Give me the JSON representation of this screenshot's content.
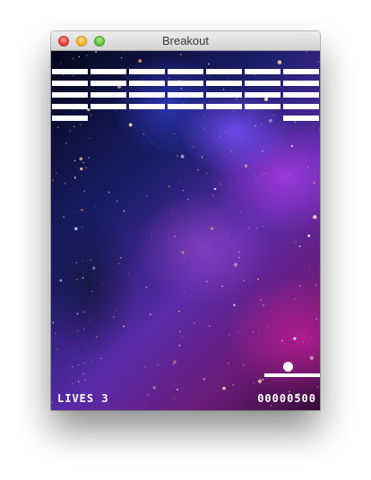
{
  "window": {
    "title": "Breakout"
  },
  "hud": {
    "lives_text": "LIVES 3",
    "score_text": "00000500"
  },
  "game": {
    "lives": 3,
    "score": 500,
    "brick_color": "#ffffff",
    "paddle_color": "#ffffff",
    "ball_color": "#ffffff",
    "background": "space nebula",
    "bricks": {
      "columns": 7,
      "rows": 5,
      "present": [
        [
          1,
          1,
          1,
          1,
          1,
          1,
          1
        ],
        [
          1,
          1,
          1,
          1,
          1,
          1,
          1
        ],
        [
          1,
          1,
          1,
          1,
          1,
          1,
          1
        ],
        [
          1,
          1,
          1,
          1,
          1,
          1,
          1
        ],
        [
          1,
          0,
          0,
          0,
          0,
          0,
          1
        ]
      ]
    }
  }
}
